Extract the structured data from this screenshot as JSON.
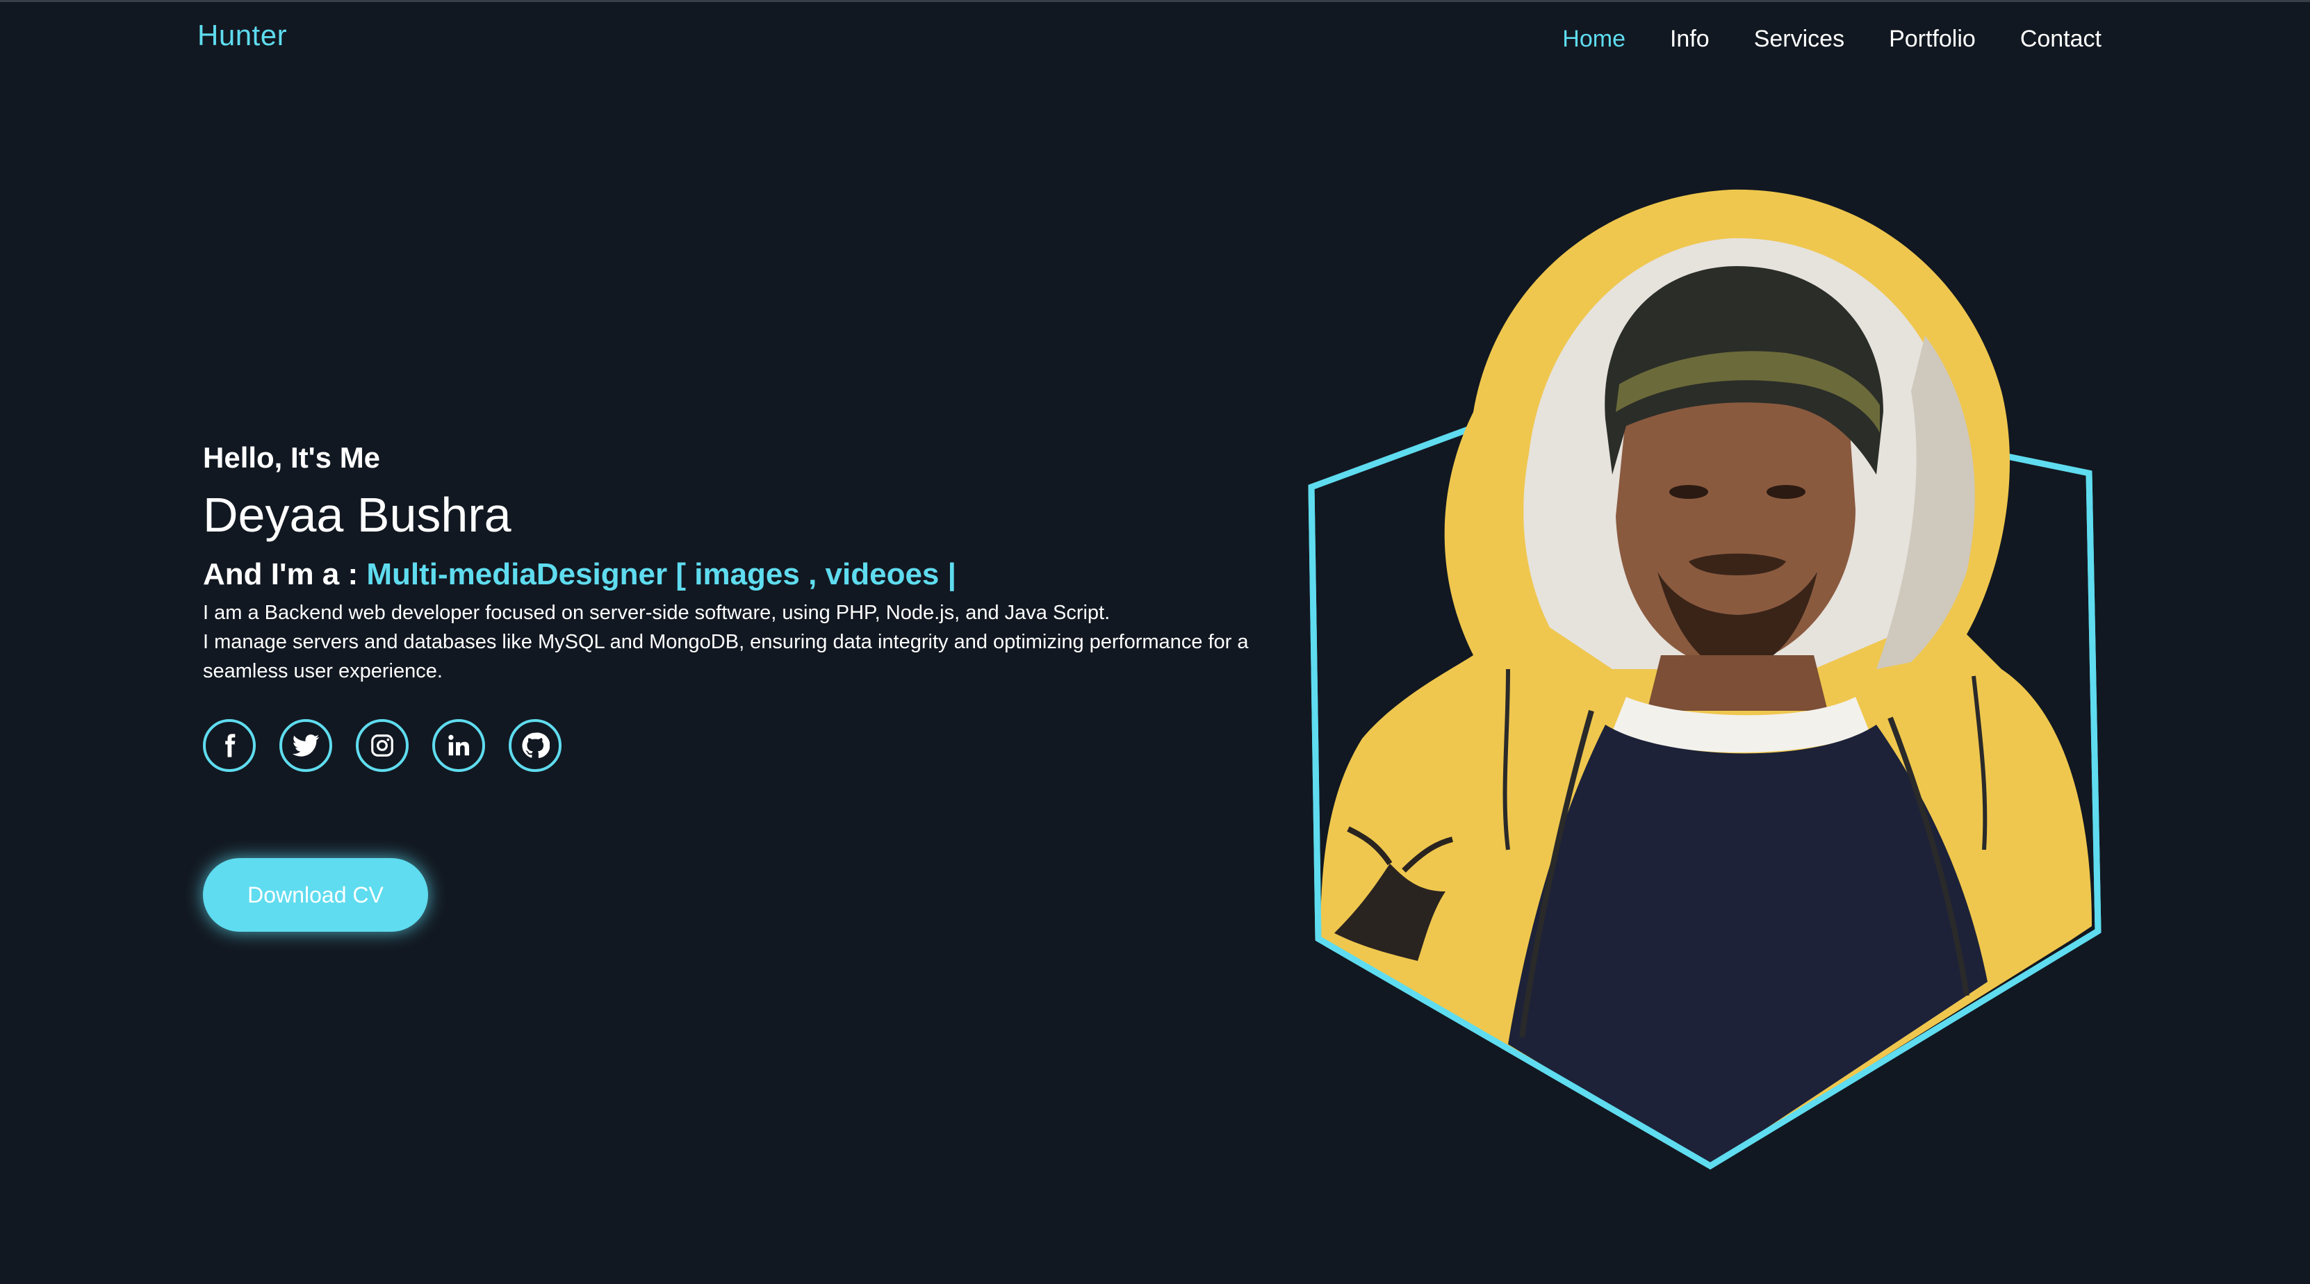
{
  "nav": {
    "logo": "Hunter",
    "links": [
      {
        "label": "Home",
        "active": true
      },
      {
        "label": "Info",
        "active": false
      },
      {
        "label": "Services",
        "active": false
      },
      {
        "label": "Portfolio",
        "active": false
      },
      {
        "label": "Contact",
        "active": false
      }
    ]
  },
  "hero": {
    "greeting": "Hello, It's Me",
    "name": "Deyaa Bushra",
    "role_prefix": "And I'm a : ",
    "role_highlight": "Multi-mediaDesigner [ images , videoes |",
    "description_lines": [
      "I am a Backend web developer focused on server-side software, using PHP, Node.js, and Java Script.",
      "I manage servers and databases like MySQL and MongoDB, ensuring data integrity and optimizing performance for a seamless user experience."
    ]
  },
  "socials": [
    {
      "icon": "facebook-icon"
    },
    {
      "icon": "twitter-icon"
    },
    {
      "icon": "instagram-icon"
    },
    {
      "icon": "linkedin-icon"
    },
    {
      "icon": "github-icon"
    }
  ],
  "cta": {
    "label": "Download CV"
  },
  "colors": {
    "background": "#121821",
    "accent": "#5fdcef",
    "text": "#ffffff"
  }
}
